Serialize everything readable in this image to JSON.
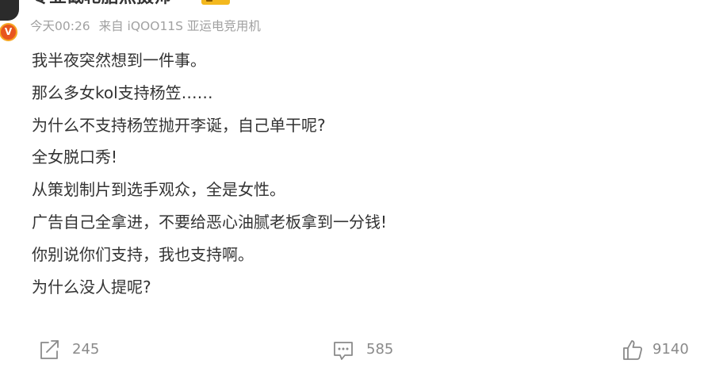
{
  "author": {
    "name": "专业截轮胎照摄师",
    "badge": "V"
  },
  "meta": {
    "time": "今天00:26",
    "source": "来自 iQOO11S 亚运电竞用机"
  },
  "post": {
    "lines": [
      "我半夜突然想到一件事。",
      "那么多女kol支持杨笠……",
      "为什么不支持杨笠抛开李诞，自己单干呢?",
      "全女脱口秀!",
      "从策划制片到选手观众，全是女性。",
      "广告自己全拿进，不要给恶心油腻老板拿到一分钱!",
      "你别说你们支持，我也支持啊。",
      "为什么没人提呢?"
    ]
  },
  "actions": {
    "repost": {
      "icon": "repost-icon",
      "count": "245"
    },
    "comment": {
      "icon": "comment-icon",
      "count": "585"
    },
    "like": {
      "icon": "thumbs-up-icon",
      "count": "9140"
    }
  },
  "colors": {
    "text": "#333333",
    "meta": "#a1a1a1",
    "action_count": "#8a8a8a",
    "icon": "#8a8a8a",
    "verified_badge": "#e8551f",
    "level_badge": "#f3b81e"
  }
}
